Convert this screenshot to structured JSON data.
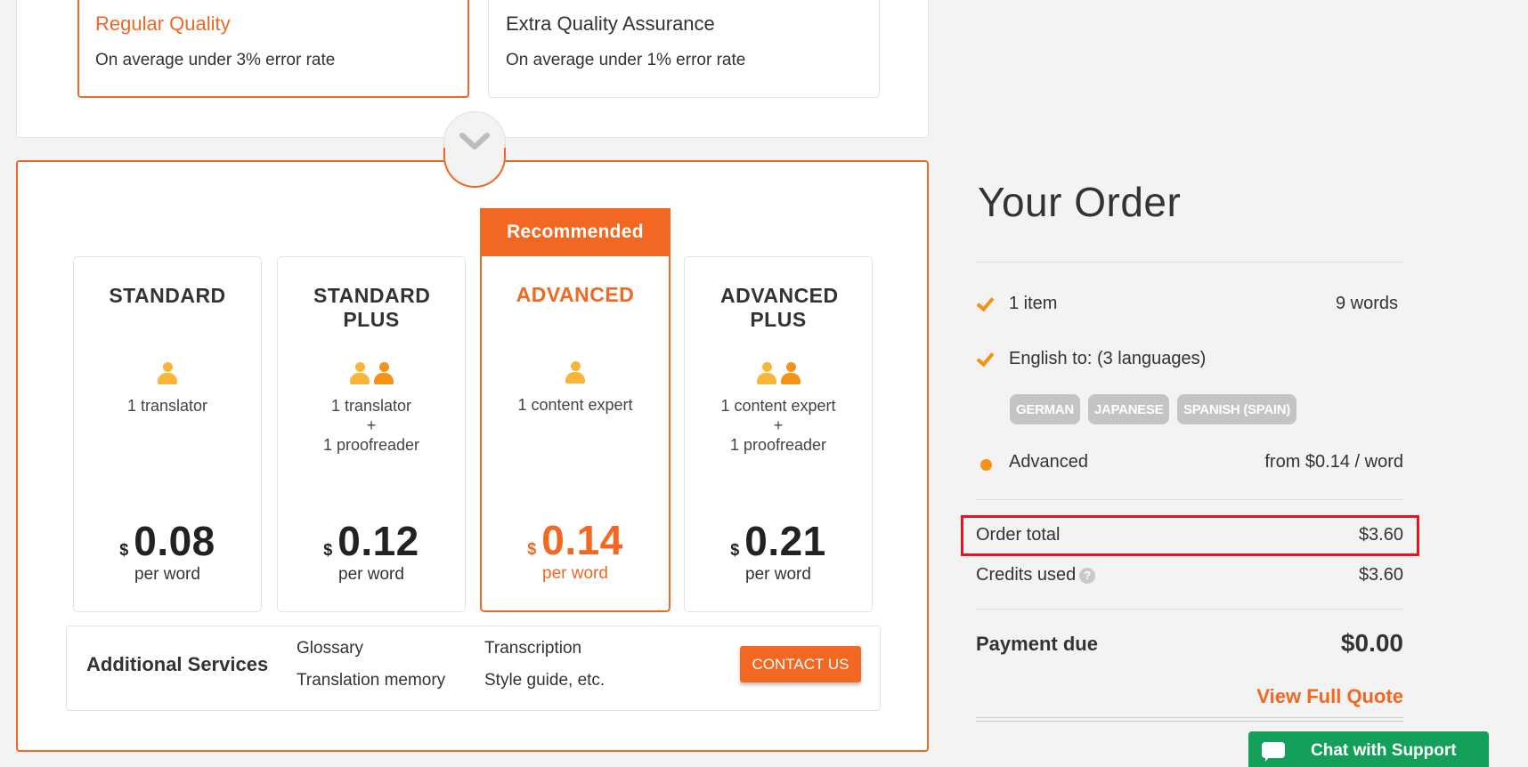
{
  "quality": {
    "options": [
      {
        "title": "Regular Quality",
        "desc": "On average under 3% error rate"
      },
      {
        "title": "Extra Quality Assurance",
        "desc": "On average under 1% error rate"
      }
    ]
  },
  "plans": {
    "recommended_label": "Recommended",
    "items": [
      {
        "name": "STANDARD",
        "team": "1 translator",
        "currency": "$",
        "price": "0.08",
        "unit": "per word"
      },
      {
        "name": "STANDARD PLUS",
        "team1": "1 translator",
        "team_plus": "+",
        "team2": "1 proofreader",
        "currency": "$",
        "price": "0.12",
        "unit": "per word"
      },
      {
        "name": "ADVANCED",
        "team": "1 content expert",
        "currency": "$",
        "price": "0.14",
        "unit": "per word"
      },
      {
        "name": "ADVANCED PLUS",
        "team1": "1 content expert",
        "team_plus": "+",
        "team2": "1 proofreader",
        "currency": "$",
        "price": "0.21",
        "unit": "per word"
      }
    ]
  },
  "additional_services": {
    "title": "Additional Services",
    "services": [
      "Glossary",
      "Translation memory",
      "Transcription",
      "Style guide, etc."
    ],
    "contact_label": "CONTACT US"
  },
  "order": {
    "title": "Your Order",
    "items_label": "1 item",
    "words": "9 words",
    "languages_label": "English to: (3 languages)",
    "languages": [
      "GERMAN",
      "JAPANESE",
      "SPANISH (SPAIN)"
    ],
    "plan_label": "Advanced",
    "plan_price": "from $0.14 / word",
    "order_total_label": "Order total",
    "order_total": "$3.60",
    "credits_label": "Credits used",
    "credits_help": "?",
    "credits": "$3.60",
    "payment_due_label": "Payment due",
    "payment_due": "$0.00",
    "view_quote": "View Full Quote"
  },
  "support": {
    "chat_label": "Chat with Support"
  },
  "colors": {
    "accent": "#f26722",
    "icon_orange": "#f59114",
    "chat_green": "#14a05a",
    "highlight_red": "#e8131d"
  }
}
